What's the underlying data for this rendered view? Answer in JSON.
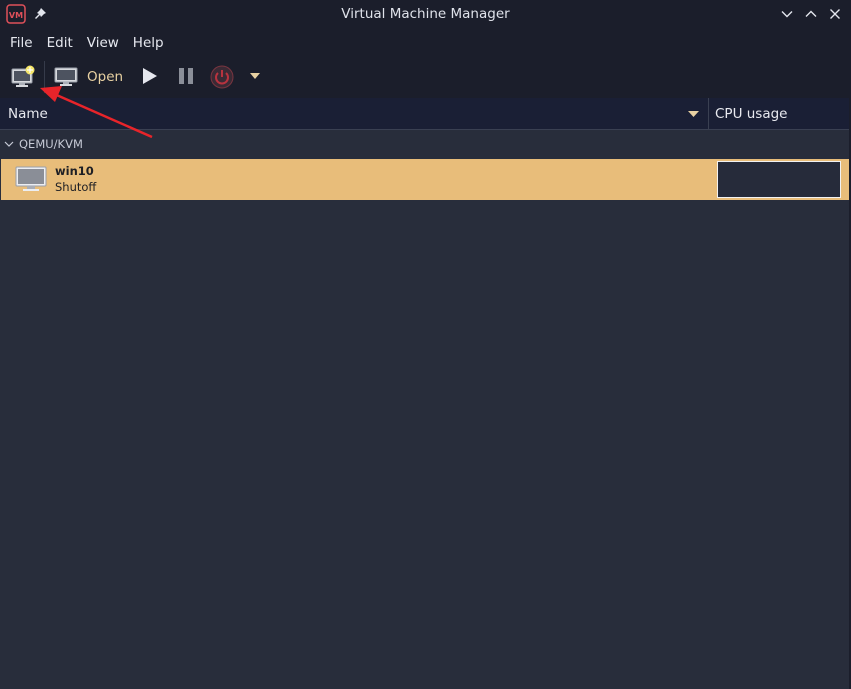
{
  "window": {
    "title": "Virtual Machine Manager"
  },
  "menubar": {
    "items": [
      "File",
      "Edit",
      "View",
      "Help"
    ]
  },
  "toolbar": {
    "open_label": "Open"
  },
  "columns": {
    "name": "Name",
    "cpu": "CPU usage"
  },
  "connection": {
    "label": "QEMU/KVM",
    "vms": [
      {
        "name": "win10",
        "status": "Shutoff"
      }
    ]
  },
  "colors": {
    "titlebar_bg": "#1b1e2b",
    "content_bg": "#282d3b",
    "selected_row": "#e8bd7a",
    "annotation_arrow": "#e8242a",
    "accent_text": "#e8d1a2"
  }
}
